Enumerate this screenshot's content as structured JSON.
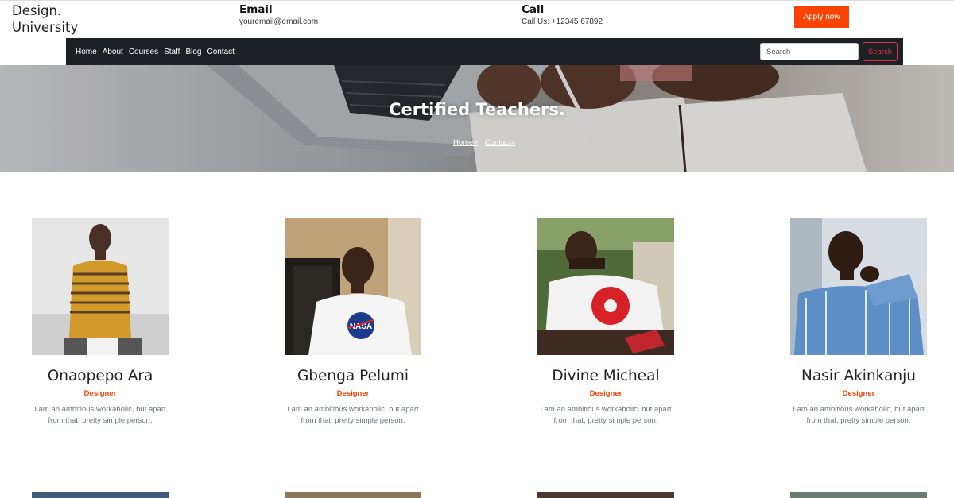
{
  "header": {
    "brand_line1": "Design.",
    "brand_line2": "University",
    "email_label": "Email",
    "email_value": "youremail@email.com",
    "call_label": "Call",
    "call_value": "Call Us: +12345 67892",
    "apply_label": "Apply now"
  },
  "nav": {
    "links": [
      "Home",
      "About",
      "Courses",
      "Staff",
      "Blog",
      "Contact"
    ],
    "search_placeholder": "Search",
    "search_button": "Search"
  },
  "hero": {
    "title": "Certified Teachers.",
    "breadcrumbs": [
      "Home>",
      "Contact>"
    ]
  },
  "teachers": [
    {
      "name": "Onaopepo Ara",
      "role": "Designer",
      "bio": "I am an ambitious workaholic, but apart from that, pretty simple person."
    },
    {
      "name": "Gbenga Pelumi",
      "role": "Designer",
      "bio": "I am an ambitious workaholic, but apart from that, pretty simple person."
    },
    {
      "name": "Divine Micheal",
      "role": "Designer",
      "bio": "I am an ambitious workaholic, but apart from that, pretty simple person."
    },
    {
      "name": "Nasir Akinkanju",
      "role": "Designer",
      "bio": "I am an ambitious workaholic, but apart from that, pretty simple person."
    }
  ],
  "colors": {
    "accent": "#fb4303",
    "navbar": "#1d2025",
    "search_outline": "#dc3545"
  }
}
